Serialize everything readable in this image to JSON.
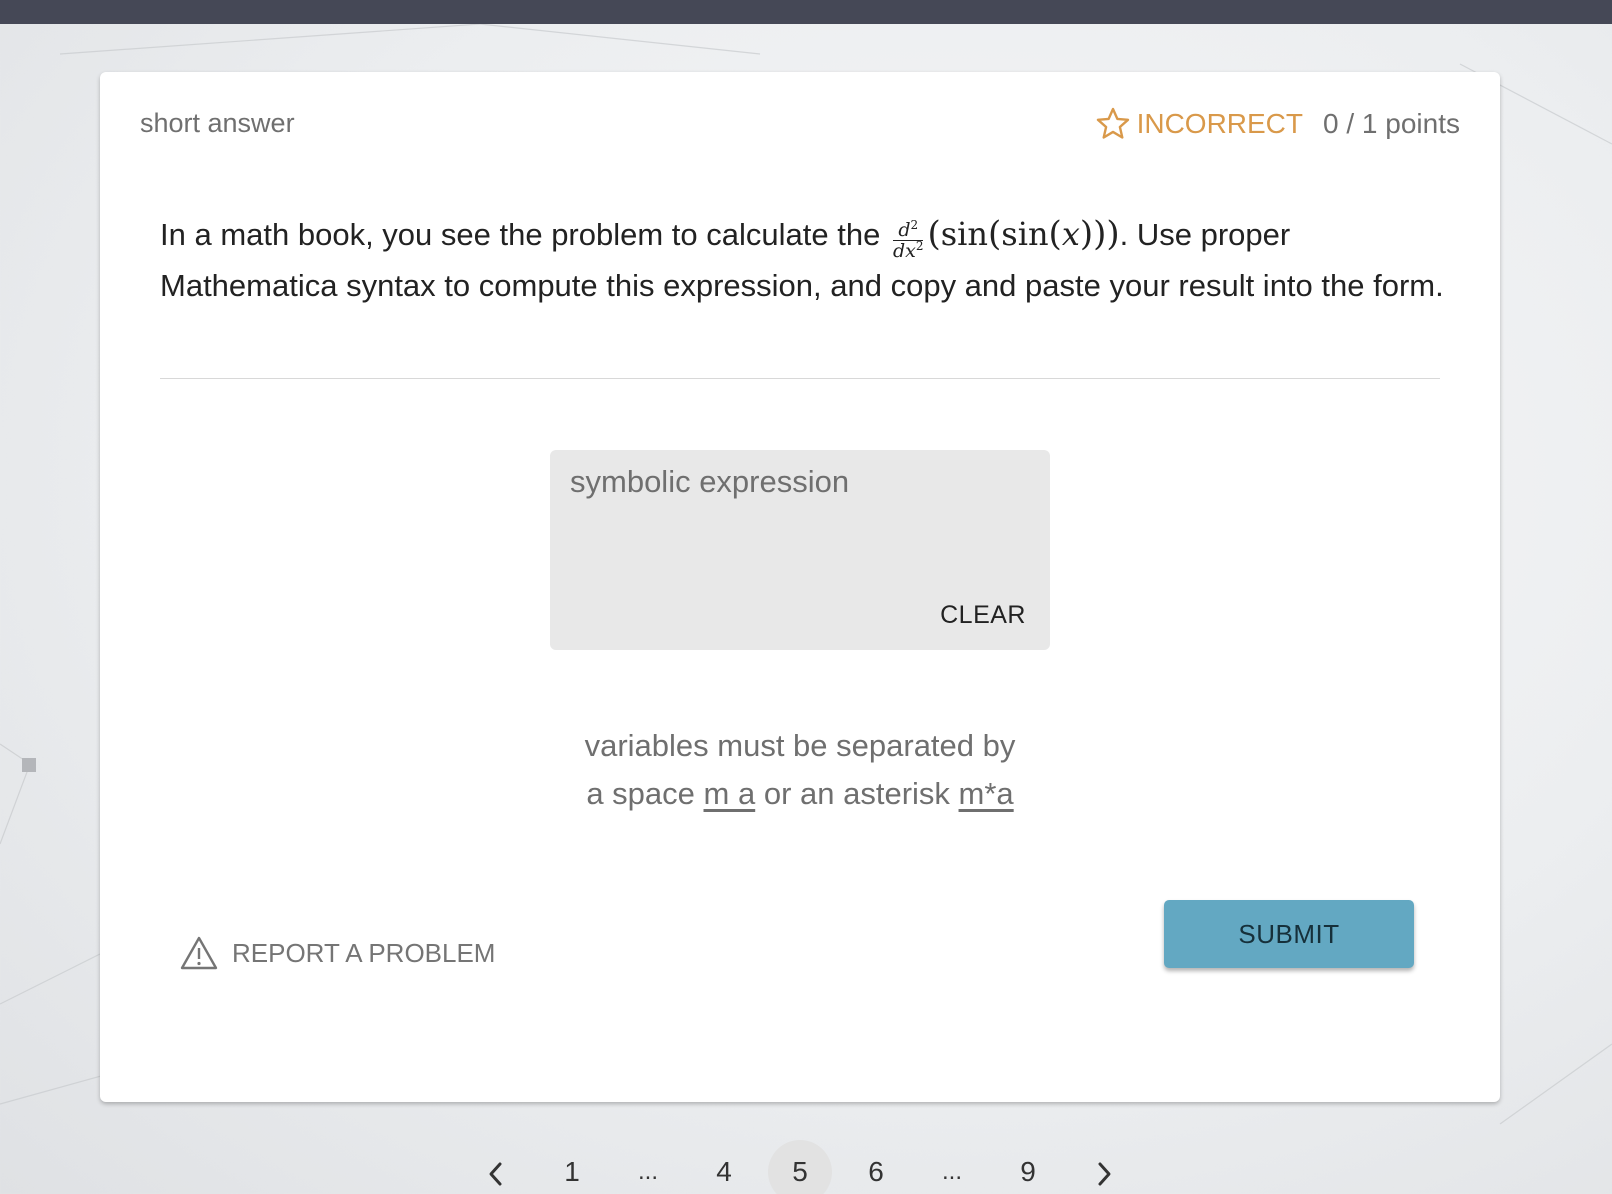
{
  "header": {
    "question_type": "short answer",
    "status_label": "INCORRECT",
    "points": "0 / 1 points"
  },
  "question": {
    "text_before": "In a math book, you see the problem to calculate the",
    "math": {
      "numerator": "d",
      "numerator_power": "2",
      "denominator": "dx",
      "denominator_power": "2",
      "expression_open": "(",
      "fn_outer": "sin",
      "fn_inner": "sin",
      "var": "x",
      "expression_close": ")))"
    },
    "text_after": ". Use proper Mathematica syntax to compute this expression, and copy and paste your result into the form."
  },
  "answer": {
    "value": "",
    "placeholder": "symbolic expression",
    "clear_label": "CLEAR"
  },
  "hint": {
    "line1": "variables must be separated by",
    "line2_a": "a space",
    "example_space": "m a",
    "line2_b": "or an asterisk",
    "example_asterisk": "m*a"
  },
  "actions": {
    "report_label": "REPORT A PROBLEM",
    "submit_label": "SUBMIT"
  },
  "pagination": {
    "pages": [
      "1",
      "...",
      "4",
      "5",
      "6",
      "...",
      "9"
    ],
    "current": "5"
  },
  "colors": {
    "topbar": "#454856",
    "incorrect": "#d9994a",
    "submit": "#63a8c2"
  }
}
